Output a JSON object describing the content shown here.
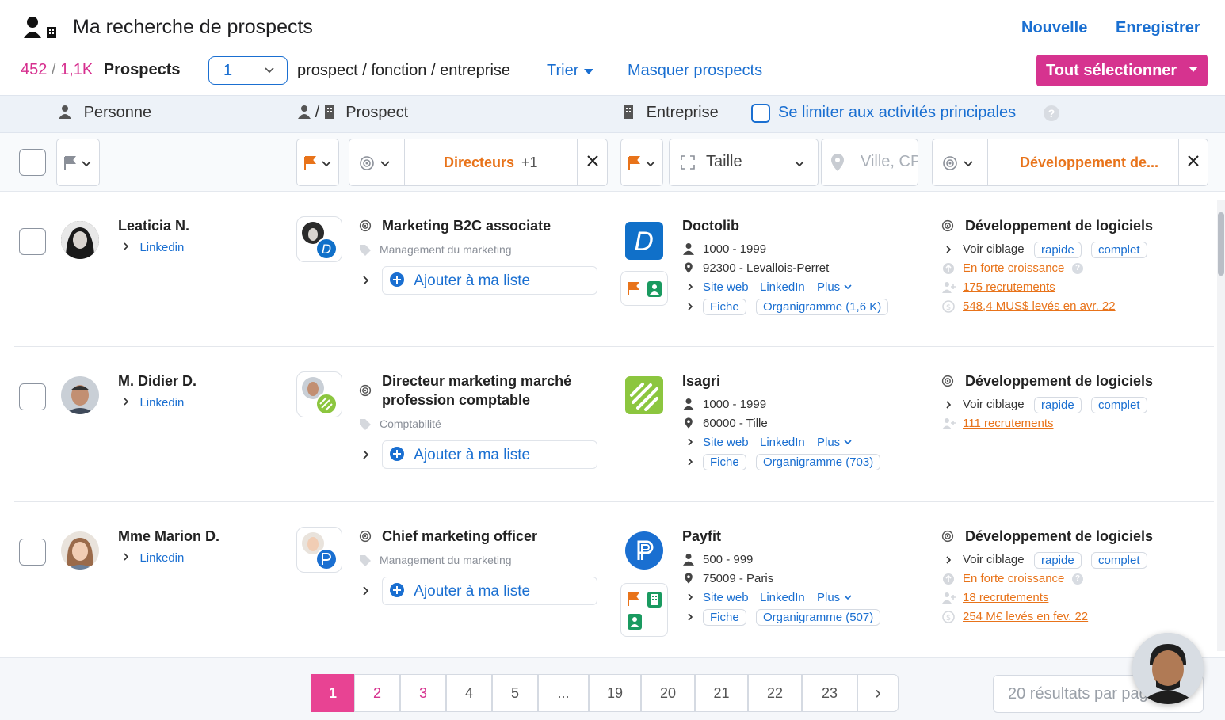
{
  "header": {
    "title": "Ma recherche de prospects",
    "new_label": "Nouvelle",
    "save_label": "Enregistrer"
  },
  "toolbar": {
    "count_shown": "452",
    "count_sep": "/",
    "count_total": "1,1K",
    "count_label": "Prospects",
    "per_company_value": "1",
    "per_company_desc": "prospect / fonction / entreprise",
    "sort_label": "Trier",
    "hide_label": "Masquer prospects",
    "select_all_label": "Tout sélectionner"
  },
  "columns": {
    "person": "Personne",
    "prospect_sep": "/",
    "prospect": "Prospect",
    "company": "Entreprise",
    "main_activities": "Se limiter aux activités principales"
  },
  "filters": {
    "function_value": "Directeurs",
    "function_extra": "+1",
    "size_placeholder": "Taille",
    "city_placeholder": "Ville, CP",
    "activity_value": "Développement de..."
  },
  "rows": [
    {
      "name": "Leaticia N.",
      "linkedin": "Linkedin",
      "job_title": "Marketing B2C associate",
      "job_category": "Management du marketing",
      "add_label": "Ajouter à ma liste",
      "company": "Doctolib",
      "company_size": "1000 - 1999",
      "company_location": "92300 - Levallois-Perret",
      "site_web": "Site web",
      "company_linkedin": "LinkedIn",
      "plus": "Plus",
      "fiche": "Fiche",
      "organigram": "Organigramme (1,6 K)",
      "activity": "Développement de logiciels",
      "voir_ciblage": "Voir ciblage",
      "rapide": "rapide",
      "complet": "complet",
      "growth": "En forte croissance",
      "recruitments": "175 recrutements",
      "funding": "548,4 MUS$ levés en avr. 22"
    },
    {
      "name": "M. Didier D.",
      "linkedin": "Linkedin",
      "job_title_1": "Directeur marketing marché",
      "job_title_2": "profession comptable",
      "job_category": "Comptabilité",
      "add_label": "Ajouter à ma liste",
      "company": "Isagri",
      "company_size": "1000 - 1999",
      "company_location": "60000 - Tille",
      "site_web": "Site web",
      "company_linkedin": "LinkedIn",
      "plus": "Plus",
      "fiche": "Fiche",
      "organigram": "Organigramme (703)",
      "activity": "Développement de logiciels",
      "voir_ciblage": "Voir ciblage",
      "rapide": "rapide",
      "complet": "complet",
      "recruitments": "111 recrutements"
    },
    {
      "name": "Mme Marion D.",
      "linkedin": "Linkedin",
      "job_title": "Chief marketing officer",
      "job_category": "Management du marketing",
      "add_label": "Ajouter à ma liste",
      "company": "Payfit",
      "company_size": "500 - 999",
      "company_location": "75009 - Paris",
      "site_web": "Site web",
      "company_linkedin": "LinkedIn",
      "plus": "Plus",
      "fiche": "Fiche",
      "organigram": "Organigramme (507)",
      "activity": "Développement de logiciels",
      "voir_ciblage": "Voir ciblage",
      "rapide": "rapide",
      "complet": "complet",
      "growth": "En forte croissance",
      "recruitments": "18 recrutements",
      "funding": "254 M€ levés en fev. 22"
    }
  ],
  "pagination": {
    "pages": [
      "1",
      "2",
      "3",
      "4",
      "5",
      "...",
      "19",
      "20",
      "21",
      "22",
      "23"
    ],
    "next": "›",
    "per_page": "20 résultats par page"
  },
  "colors": {
    "accent_blue": "#1a6fd1",
    "brand_pink": "#d6338f",
    "orange": "#e8731a"
  }
}
